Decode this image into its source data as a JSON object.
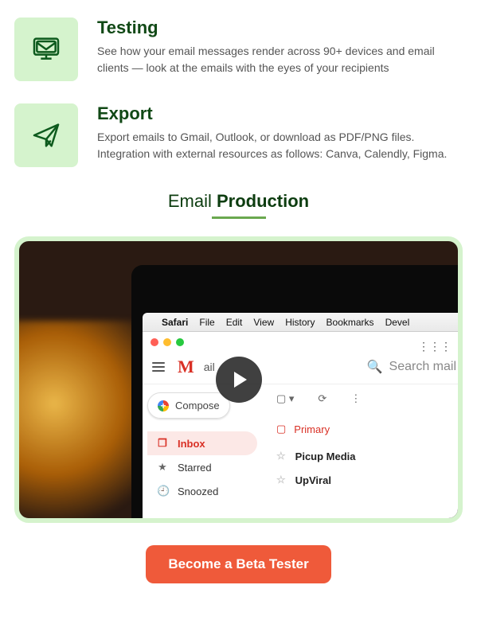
{
  "features": [
    {
      "title": "Testing",
      "desc": "See how your email messages render across 90+ devices and email clients — look at the emails with the eyes of your recipients"
    },
    {
      "title": "Export",
      "desc": "Export emails to Gmail, Outlook, or download as PDF/PNG files. Integration with external resources as follows: Canva, Calendly, Figma."
    }
  ],
  "section_title": {
    "light": "Email ",
    "bold": "Production"
  },
  "safari_menu": [
    "Safari",
    "File",
    "Edit",
    "View",
    "History",
    "Bookmarks",
    "Devel"
  ],
  "gmail": {
    "logo_tail": "ail",
    "search": "Search mail",
    "compose": "Compose",
    "side": [
      {
        "icon": "📥",
        "label": "Inbox",
        "active": true
      },
      {
        "icon": "★",
        "label": "Starred",
        "active": false
      },
      {
        "icon": "🕘",
        "label": "Snoozed",
        "active": false
      }
    ],
    "primary_tab": "Primary",
    "mails": [
      "Picup Media",
      "UpViral"
    ]
  },
  "cta": "Become a Beta Tester"
}
